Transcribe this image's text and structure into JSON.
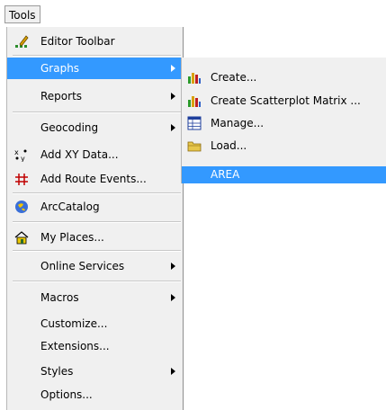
{
  "menubar": {
    "tools_label": "Tools"
  },
  "menu": {
    "items": [
      {
        "label": "Editor Toolbar"
      },
      {
        "label": "Graphs"
      },
      {
        "label": "Reports"
      },
      {
        "label": "Geocoding"
      },
      {
        "label": "Add XY Data..."
      },
      {
        "label": "Add Route Events..."
      },
      {
        "label": "ArcCatalog"
      },
      {
        "label": "My Places..."
      },
      {
        "label": "Online Services"
      },
      {
        "label": "Macros"
      },
      {
        "label": "Customize..."
      },
      {
        "label": "Extensions..."
      },
      {
        "label": "Styles"
      },
      {
        "label": "Options..."
      }
    ]
  },
  "submenu": {
    "items": [
      {
        "label": "Create..."
      },
      {
        "label": "Create Scatterplot Matrix ..."
      },
      {
        "label": "Manage..."
      },
      {
        "label": "Load..."
      },
      {
        "label": "AREA"
      }
    ]
  },
  "colors": {
    "highlight": "#3399ff",
    "menu_bg": "#f0f0f0"
  },
  "icons": {
    "editor_toolbar": "editor-toolbar-icon",
    "add_xy_data": "xy-data-icon",
    "add_route_events": "route-events-icon",
    "arccatalog": "arccatalog-icon",
    "my_places": "home-icon",
    "create": "bar-chart-icon",
    "create_scatterplot": "bar-chart-icon",
    "manage": "table-icon",
    "load": "folder-icon"
  }
}
